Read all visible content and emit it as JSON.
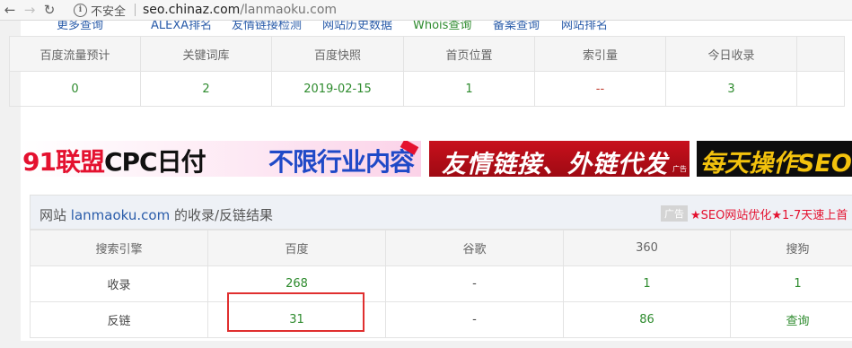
{
  "browser": {
    "security_label": "不安全",
    "url_domain": "seo.chinaz.com",
    "url_path": "/lanmaoku.com"
  },
  "top_links": [
    "更多查询",
    "ALEXA排名",
    "友情链接检测",
    "网站历史数据",
    "Whois查询",
    "备案查询",
    "网站排名"
  ],
  "summary_table": {
    "headers": [
      "百度流量预计",
      "关键词库",
      "百度快照",
      "首页位置",
      "索引量",
      "今日收录"
    ],
    "values": [
      "0",
      "2",
      "2019-02-15",
      "1",
      "--",
      "3"
    ]
  },
  "ads": {
    "ad1_part1": "91联盟",
    "ad1_part2": "CPC日付",
    "ad1_part3": "不限行业内容",
    "ad2_text": "友情链接、外链代发",
    "ad2_mini": "广告",
    "ad3_text": "每天操作SEO"
  },
  "results": {
    "title_prefix": "网站",
    "domain": "lanmaoku.com",
    "title_suffix": "的收录/反链结果",
    "ad_label": "广告",
    "ad_text": "★SEO网站优化★1-7天速上首",
    "headers": [
      "搜索引擎",
      "百度",
      "谷歌",
      "360",
      "搜狗"
    ],
    "rows": [
      {
        "label": "收录",
        "baidu": "268",
        "google": "-",
        "so360": "1",
        "sogou": "1"
      },
      {
        "label": "反链",
        "baidu": "31",
        "google": "-",
        "so360": "86",
        "sogou": "查询"
      }
    ]
  },
  "colors": {
    "green": "#2e8b2e",
    "link_blue": "#2a5caa",
    "highlight_red": "#e02f2f"
  }
}
